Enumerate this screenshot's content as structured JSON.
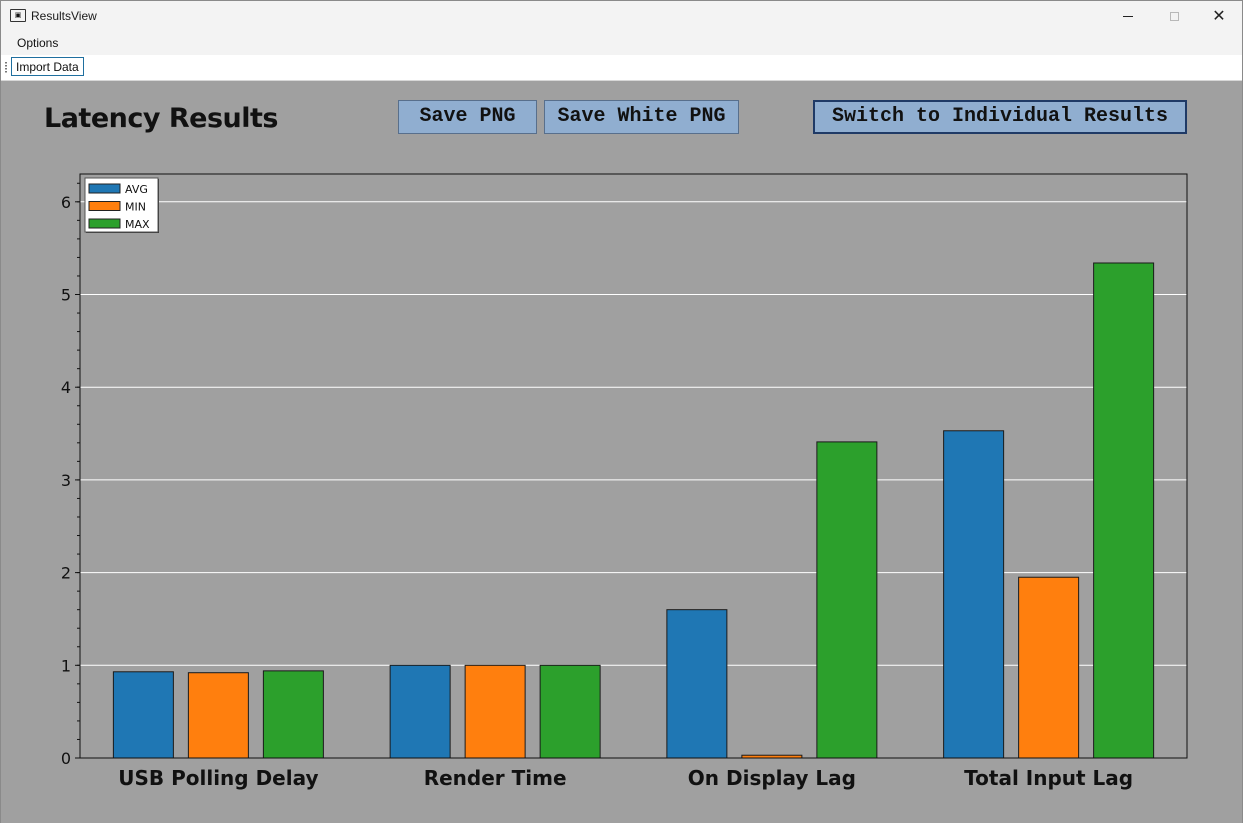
{
  "window": {
    "title": "ResultsView",
    "app_icon": "monitor-icon"
  },
  "menu": {
    "options": "Options"
  },
  "toolbar": {
    "import_data": "Import Data"
  },
  "header": {
    "title": "Latency Results",
    "save_png": "Save PNG",
    "save_white_png": "Save White PNG",
    "switch_results": "Switch to Individual Results"
  },
  "colors": {
    "avg": "#1f77b4",
    "min": "#ff7f0e",
    "max": "#2ca02c",
    "background": "#a0a0a0",
    "button": "#90aed0"
  },
  "chart_data": {
    "type": "bar",
    "title": "",
    "xlabel": "",
    "ylabel": "",
    "ylim": [
      0,
      6.3
    ],
    "yticks": [
      0,
      1,
      2,
      3,
      4,
      5,
      6
    ],
    "grid": true,
    "legend_position": "top-left",
    "categories": [
      "USB Polling Delay",
      "Render Time",
      "On Display Lag",
      "Total Input Lag"
    ],
    "series": [
      {
        "name": "AVG",
        "color": "#1f77b4",
        "values": [
          0.93,
          1.0,
          1.6,
          3.53
        ]
      },
      {
        "name": "MIN",
        "color": "#ff7f0e",
        "values": [
          0.92,
          1.0,
          0.03,
          1.95
        ]
      },
      {
        "name": "MAX",
        "color": "#2ca02c",
        "values": [
          0.94,
          1.0,
          3.41,
          5.34
        ]
      }
    ]
  }
}
